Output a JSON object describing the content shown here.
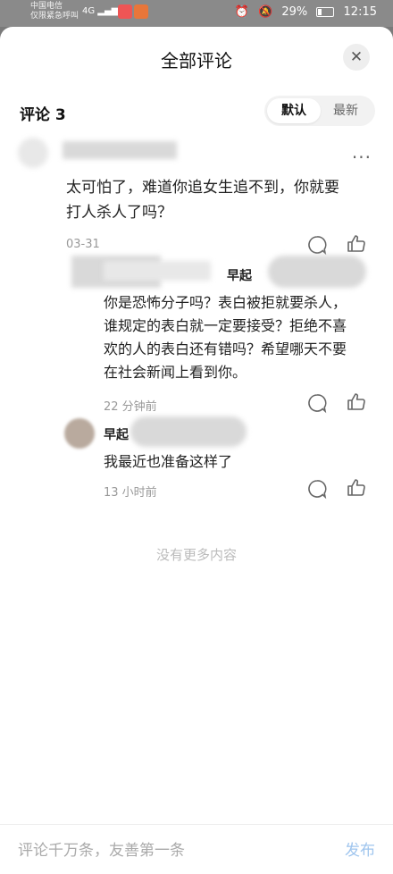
{
  "status_bar": {
    "carrier_line1": "中国电信",
    "carrier_line2": "仅限紧急呼叫",
    "network": "4G",
    "battery": "29%",
    "time": "12:15"
  },
  "sheet": {
    "title": "全部评论",
    "comment_count_label": "评论 3",
    "sort_default": "默认",
    "sort_latest": "最新"
  },
  "comments": [
    {
      "text_line1": "太可怕了，难道你追女生追不到，你就要",
      "text_line2": "打人杀人了吗？",
      "time": "03-31",
      "replies": [
        {
          "name": "早起",
          "lines": [
            "你是恐怖分子吗？表白被拒就要杀人，",
            "谁规定的表白就一定要接受？拒绝不喜",
            "欢的人的表白还有错吗？希望哪天不要",
            "在社会新闻上看到你。"
          ],
          "time": "22 分钟前"
        },
        {
          "name": "早起",
          "lines": [
            "我最近也准备这样了"
          ],
          "time": "13 小时前"
        }
      ]
    }
  ],
  "end_note": "没有更多内容",
  "bottom": {
    "input_placeholder": "评论千万条，友善第一条",
    "publish_label": "发布"
  }
}
